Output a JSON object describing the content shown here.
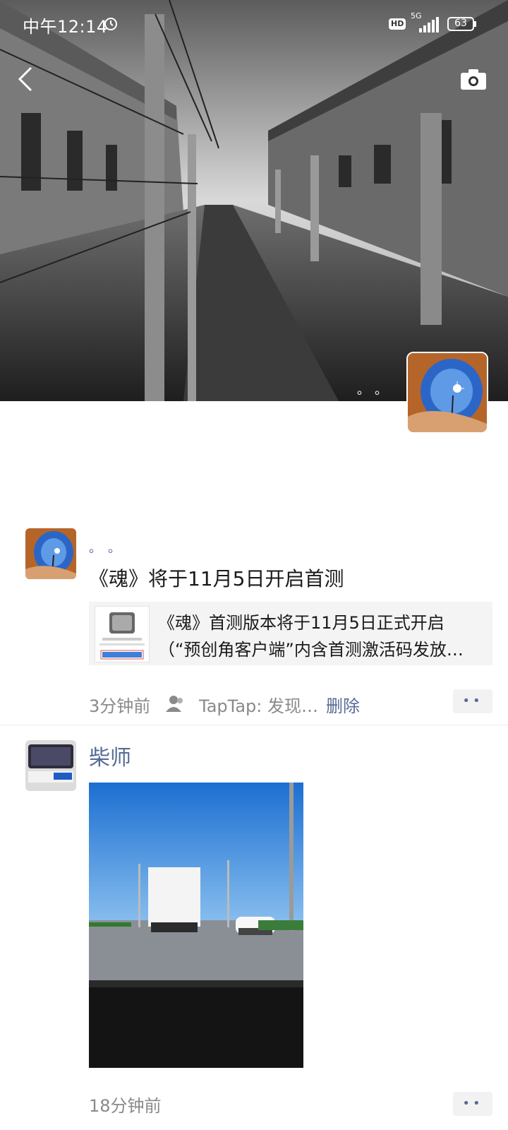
{
  "status_bar": {
    "time": "中午12:14",
    "hd": "HD",
    "network": "5G",
    "battery": "63"
  },
  "cover": {
    "dots": "。。"
  },
  "posts": [
    {
      "dots": "。。",
      "title": "《魂》将于11月5日开启首测",
      "link": {
        "line1": "《魂》首测版本将于11月5日正式开启",
        "line2": "（“预创角客户端”内含首测激活码发放…"
      },
      "time": "3分钟前",
      "source": "TapTap: 发现…",
      "delete": "删除",
      "more": "••"
    },
    {
      "username": "柴师",
      "time": "18分钟前",
      "more": "••"
    }
  ],
  "icons": [
    "back-arrow-icon",
    "camera-icon",
    "alarm-icon",
    "signal-icon",
    "battery-icon",
    "people-icon"
  ],
  "colors": {
    "link_blue": "#576b95",
    "meta_gray": "#8a8a8a"
  }
}
